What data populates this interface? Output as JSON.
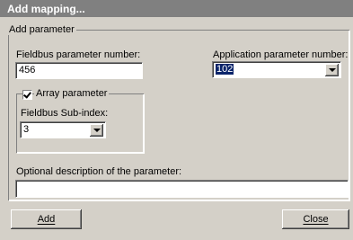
{
  "window": {
    "title": "Add mapping..."
  },
  "group": {
    "label": "Add parameter",
    "fieldbus_param_label": "Fieldbus parameter number:",
    "fieldbus_param_value": "456",
    "app_param_label": "Application parameter number:",
    "app_param_value": "102",
    "array": {
      "label": "Array parameter",
      "checked": true,
      "subindex_label": "Fieldbus Sub-index:",
      "subindex_value": "3"
    },
    "description_label": "Optional description of the parameter:",
    "description_value": ""
  },
  "buttons": {
    "add_label": "Add",
    "close_label": "Close"
  }
}
